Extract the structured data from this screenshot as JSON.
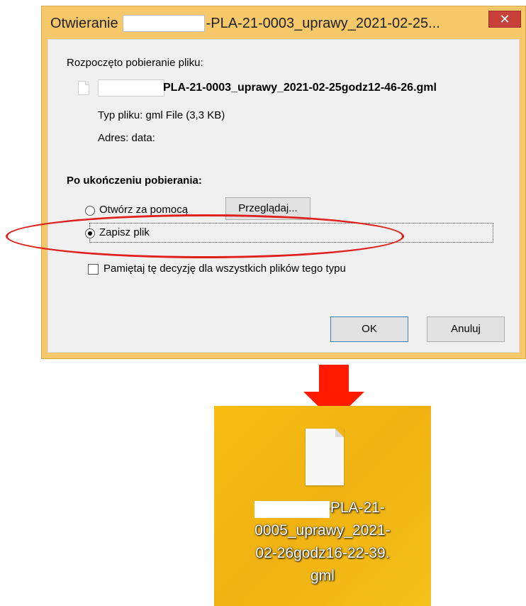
{
  "dialog": {
    "title_prefix": "Otwieranie",
    "title_suffix": "-PLA-21-0003_uprawy_2021-02-25...",
    "close_glyph": "✕",
    "intro": "Rozpoczęto pobieranie pliku:",
    "file_name": "PLA-21-0003_uprawy_2021-02-25godz12-46-26.gml",
    "type_label": "Typ pliku:",
    "type_value": "gml File (3,3 KB)",
    "address_label": "Adres:",
    "address_value": "data:",
    "after_download_heading": "Po ukończeniu pobierania:",
    "open_with_label": "Otwórz za pomocą",
    "browse_button": "Przeglądaj...",
    "save_file_label": "Zapisz plik",
    "selected_option": "Zapisz plik",
    "remember_label": "Pamiętaj tę decyzję dla wszystkich plików tego typu",
    "remember_checked": false,
    "ok_button": "OK",
    "cancel_button": "Anuluj"
  },
  "desktop_icon": {
    "label_line1": "0-PLA-21-",
    "label_line2": "0005_uprawy_2021-",
    "label_line3": "02-26godz16-22-39.",
    "label_line4": "gml"
  },
  "colors": {
    "highlight_ellipse": "#e0201c",
    "arrow": "#ff1a00",
    "desktop_background": "#f3bb15",
    "dialog_frame": "#f6c86a",
    "close_button": "#c7413a"
  }
}
